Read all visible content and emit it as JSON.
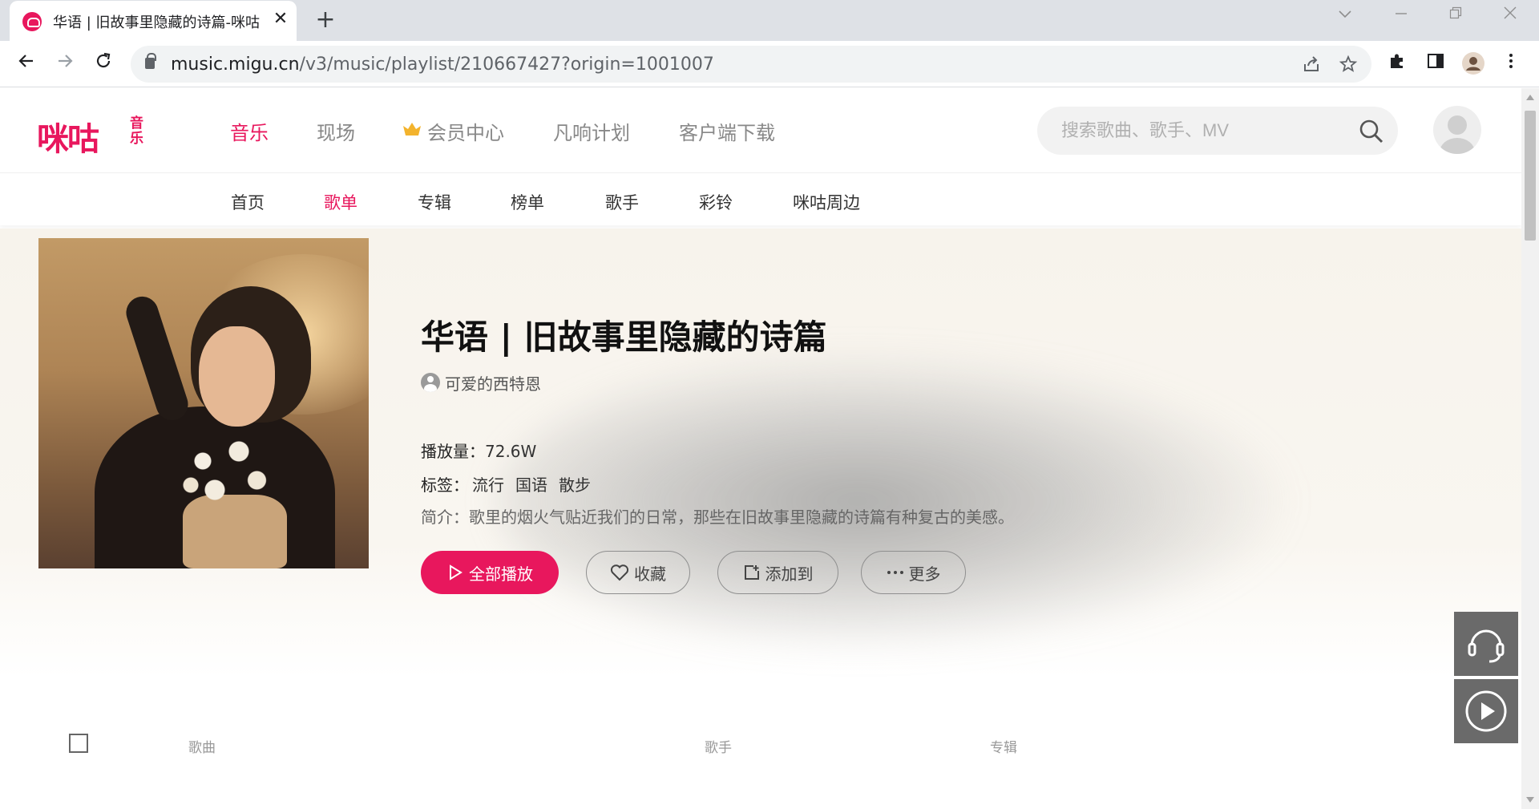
{
  "browser": {
    "tab_title": "华语 | 旧故事里隐藏的诗篇-咪咕",
    "tab_close": "✕",
    "new_tab": "+",
    "url_domain": "music.migu.cn",
    "url_path": "/v3/music/playlist/210667427?origin=1001007"
  },
  "site": {
    "logo_text": "咪咕",
    "logo_sub": "音乐",
    "main_nav": [
      "音乐",
      "现场",
      "会员中心",
      "凡响计划",
      "客户端下载"
    ],
    "search_placeholder": "搜索歌曲、歌手、MV",
    "sub_nav": [
      "首页",
      "歌单",
      "专辑",
      "榜单",
      "歌手",
      "彩铃",
      "咪咕周边"
    ],
    "accent_color": "#e8175d"
  },
  "playlist": {
    "title": "华语 | 旧故事里隐藏的诗篇",
    "creator": "可爱的西特恩",
    "play_count_label": "播放量：",
    "play_count": "72.6W",
    "tags_label": "标签：",
    "tags": [
      "流行",
      "国语",
      "散步"
    ],
    "intro_label": "简介：",
    "intro": "歌里的烟火气贴近我们的日常，那些在旧故事里隐藏的诗篇有种复古的美感。"
  },
  "actions": {
    "play_all": "全部播放",
    "favorite": "收藏",
    "add_to": "添加到",
    "more": "更多"
  },
  "song_list": {
    "columns": [
      "歌曲",
      "歌手",
      "专辑"
    ]
  }
}
